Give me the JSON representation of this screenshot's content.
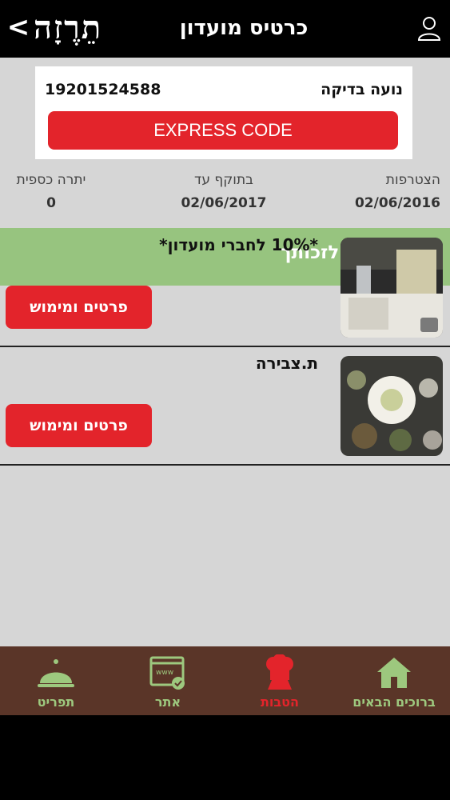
{
  "header": {
    "logo": "תֵרֶזָה",
    "title": "כרטיס מועדון",
    "back": "<"
  },
  "card": {
    "number": "19201524588",
    "name": "נועה בדיקה",
    "express_label": "EXPRESS CODE"
  },
  "info": {
    "join_label": "הצטרפות",
    "join_value": "02/06/2016",
    "valid_label": "בתוקף עד",
    "valid_value": "02/06/2017",
    "balance_label": "יתרה כספית",
    "balance_value": "0"
  },
  "benefits": {
    "title": "הטבות שיש לזכותך",
    "items": [
      {
        "title": "*10% לחברי מועדון*",
        "button": "פרטים ומימוש"
      },
      {
        "title": "ת.צבירה",
        "button": "פרטים ומימוש"
      }
    ]
  },
  "tabs": [
    {
      "label": "תפריט",
      "icon": "cloche-icon",
      "color": "#9dc87e"
    },
    {
      "label": "אתר",
      "icon": "website-icon",
      "color": "#9dc87e"
    },
    {
      "label": "הטבות",
      "icon": "chef-hat-icon",
      "color": "#e3242b"
    },
    {
      "label": "ברוכים הבאים",
      "icon": "home-icon",
      "color": "#9dc87e"
    }
  ],
  "colors": {
    "accent_red": "#e3242b",
    "green_bar": "#97c47f",
    "tabbar_bg": "#5a3528"
  }
}
